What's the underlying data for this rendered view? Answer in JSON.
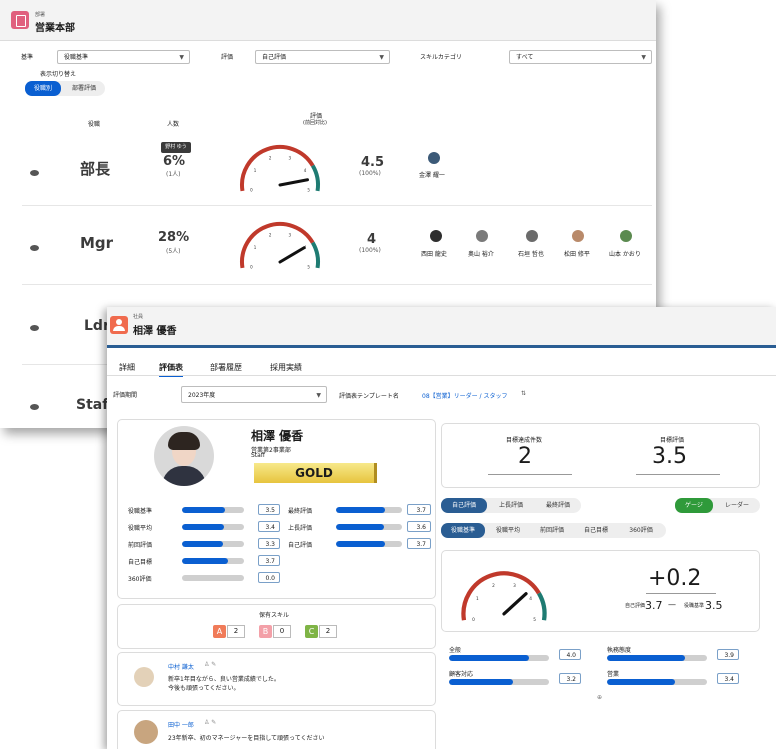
{
  "back": {
    "header": {
      "category": "部署",
      "title": "営業本部"
    },
    "filters": {
      "kijun_label": "基準",
      "kijun_value": "役職基準",
      "hyoka_label": "評価",
      "hyoka_value": "自己評価",
      "skill_label": "スキルカテゴリ",
      "skill_value": "すべて"
    },
    "toggle": {
      "label": "表示切り替え",
      "options": [
        "役職別",
        "部署評価"
      ]
    },
    "columns": {
      "role": "役職",
      "count": "人数",
      "eval": "評価",
      "eval_sub": "(前回対比)"
    },
    "tooltip": "野村 ゆう",
    "rows": [
      {
        "role": "部長",
        "pct": "6%",
        "count": "(1人)",
        "score": "4.5",
        "score_pct": "(100%)",
        "gauge": 4.5,
        "members": [
          "金澤 耀一"
        ]
      },
      {
        "role": "Mgr",
        "pct": "28%",
        "count": "(5人)",
        "score": "4",
        "score_pct": "(100%)",
        "gauge": 4.0,
        "members": [
          "西田 龍史",
          "奥山 裕介",
          "石垣 哲也",
          "松田 修平",
          "山本 かおり"
        ]
      },
      {
        "role": "Ldr"
      },
      {
        "role": "Staf"
      }
    ]
  },
  "front": {
    "header": {
      "category": "社員",
      "title": "相澤 優香"
    },
    "tabs": [
      "詳細",
      "評価表",
      "部署履歴",
      "採用実績"
    ],
    "period_label": "評価期間",
    "period_value": "2023年度",
    "template_label": "評価表テンプレート名",
    "template_value": "08【営業】リーダー / スタッフ",
    "profile": {
      "name": "相澤 優香",
      "dept": "営業第2事業部",
      "role": "Staff",
      "rank": "GOLD"
    },
    "stats_left": [
      {
        "label": "役職基準",
        "value": "3.5",
        "fill": 0.7
      },
      {
        "label": "役職平均",
        "value": "3.4",
        "fill": 0.68
      },
      {
        "label": "前回評価",
        "value": "3.3",
        "fill": 0.66
      },
      {
        "label": "自己目標",
        "value": "3.7",
        "fill": 0.74
      },
      {
        "label": "360評価",
        "value": "0.0",
        "fill": 0
      }
    ],
    "stats_right": [
      {
        "label": "最終評価",
        "value": "3.7",
        "fill": 0.74
      },
      {
        "label": "上長評価",
        "value": "3.6",
        "fill": 0.72
      },
      {
        "label": "自己評価",
        "value": "3.7",
        "fill": 0.74
      }
    ],
    "skills": {
      "title": "保有スキル",
      "items": [
        {
          "grade": "A",
          "count": "2"
        },
        {
          "grade": "B",
          "count": "0"
        },
        {
          "grade": "C",
          "count": "2"
        }
      ]
    },
    "comments": [
      {
        "name": "中村 謙太",
        "text1": "新卒1年目ながら、良い営業成績でした。",
        "text2": "今後も頑張ってください。"
      },
      {
        "name": "田中 一郎",
        "text1": "23年新卒、初のマネージャーを目指して頑張ってください",
        "text2": ""
      }
    ],
    "goals": {
      "count_label": "目標達成件数",
      "count": "2",
      "eval_label": "目標評価",
      "eval": "3.5"
    },
    "eval_tabs": [
      "自己評価",
      "上長評価",
      "最終評価"
    ],
    "view_tabs": [
      "ゲージ",
      "レーダー"
    ],
    "compare_tabs": [
      "役職基準",
      "役職平均",
      "前回評価",
      "自己目標",
      "360評価"
    ],
    "diff": {
      "value": "+0.2",
      "self_label": "自己評価",
      "self_value": "3.7",
      "base_label": "役職基準",
      "base_value": "3.5",
      "gauge": 3.7
    },
    "skill_bars": [
      {
        "label": "全般",
        "value": "4.0",
        "fill": 0.8
      },
      {
        "label": "執務態度",
        "value": "3.9",
        "fill": 0.78
      },
      {
        "label": "顧客対応",
        "value": "3.2",
        "fill": 0.64
      },
      {
        "label": "営業",
        "value": "3.4",
        "fill": 0.68
      }
    ],
    "colors": {
      "primary": "#0a5fd1",
      "navy": "#2a5d93",
      "gold": "#f0d25a",
      "gaugeRed": "#c0392b",
      "gaugeTeal": "#1e7b72"
    }
  }
}
